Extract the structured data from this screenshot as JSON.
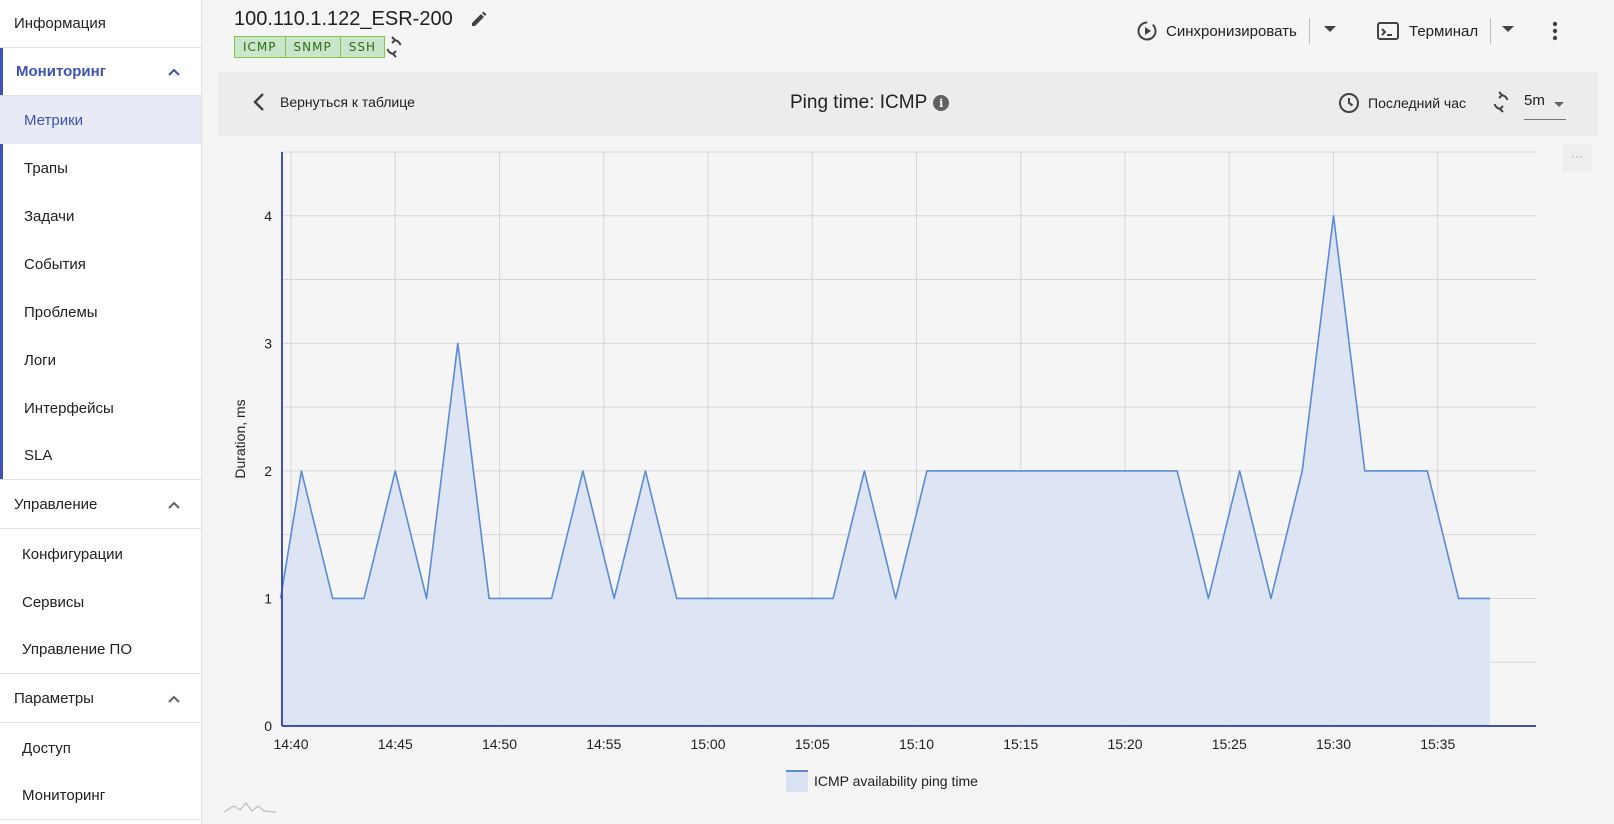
{
  "sidebar": {
    "info": "Информация",
    "monitoring": {
      "label": "Мониторинг",
      "items": [
        "Метрики",
        "Трапы",
        "Задачи",
        "События",
        "Проблемы",
        "Логи",
        "Интерфейсы",
        "SLA"
      ]
    },
    "management": {
      "label": "Управление",
      "items": [
        "Конфигурации",
        "Сервисы",
        "Управление ПО"
      ]
    },
    "params": {
      "label": "Параметры",
      "items": [
        "Доступ",
        "Мониторинг"
      ]
    }
  },
  "header": {
    "title": "100.110.1.122_ESR-200",
    "badges": [
      "ICMP",
      "SNMP",
      "SSH"
    ],
    "sync_label": "Синхронизировать",
    "terminal_label": "Терминал"
  },
  "chart_panel": {
    "back_label": "Вернуться к таблице",
    "title": "Ping time: ICMP",
    "info_glyph": "i",
    "range_label": "Последний час",
    "interval": "5m",
    "more_label": "···"
  },
  "colors": {
    "accent": "#3f51b5",
    "series_line": "#5b8bd6",
    "series_fill": "#dbe3f3",
    "badge_bg": "#c8e6c9"
  },
  "chart_data": {
    "type": "area",
    "ylabel": "Duration, ms",
    "xlabel": "",
    "ylim": [
      0,
      4.5
    ],
    "yticks": [
      0,
      1,
      2,
      3,
      4
    ],
    "xticks": [
      "14:40",
      "14:45",
      "14:50",
      "14:55",
      "15:00",
      "15:05",
      "15:10",
      "15:15",
      "15:20",
      "15:25",
      "15:30",
      "15:35"
    ],
    "series": [
      {
        "name": "ICMP availability ping time",
        "x": [
          "14:39.5",
          "14:40.5",
          "14:42",
          "14:43.5",
          "14:45",
          "14:46.5",
          "14:48",
          "14:49.5",
          "14:51",
          "14:52.5",
          "14:54",
          "14:55.5",
          "14:57",
          "14:58.5",
          "15:00",
          "15:01.5",
          "15:03",
          "15:04.5",
          "15:06",
          "15:07.5",
          "15:09",
          "15:10.5",
          "15:12",
          "15:13.5",
          "15:15",
          "15:16.5",
          "15:18",
          "15:19.5",
          "15:21",
          "15:22.5",
          "15:24",
          "15:25.5",
          "15:27",
          "15:28.5",
          "15:30",
          "15:31.5",
          "15:33",
          "15:34.5",
          "15:36",
          "15:37.5"
        ],
        "values": [
          1,
          2,
          1,
          1,
          2,
          1,
          3,
          1,
          1,
          1,
          2,
          1,
          2,
          1,
          1,
          1,
          1,
          1,
          1,
          2,
          1,
          2,
          2,
          2,
          2,
          2,
          2,
          2,
          2,
          2,
          1,
          2,
          1,
          2,
          4,
          2,
          2,
          2,
          1,
          1
        ]
      }
    ],
    "grid": true,
    "legend": "bottom-center"
  }
}
